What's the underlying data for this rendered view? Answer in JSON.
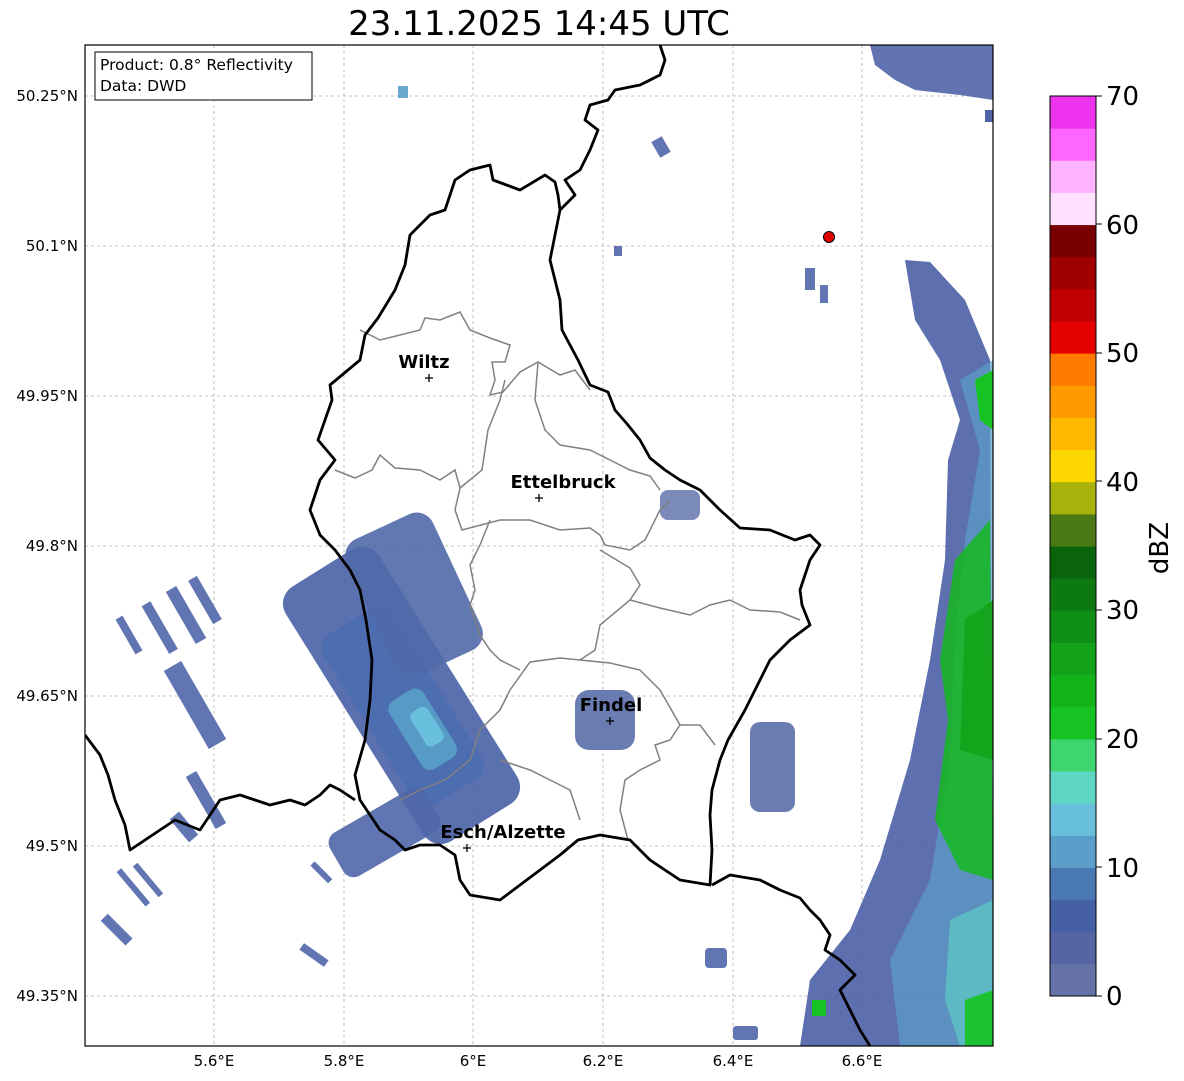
{
  "title": "23.11.2025 14:45 UTC",
  "info_box": {
    "line1": "Product: 0.8° Reflectivity",
    "line2": "Data: DWD"
  },
  "axes": {
    "lon_ticks": [
      "5.6°E",
      "5.8°E",
      "6°E",
      "6.2°E",
      "6.4°E",
      "6.6°E"
    ],
    "lat_ticks": [
      "50.25°N",
      "50.1°N",
      "49.95°N",
      "49.8°N",
      "49.65°N",
      "49.5°N",
      "49.35°N"
    ]
  },
  "cities": [
    {
      "name": "Wiltz"
    },
    {
      "name": "Ettelbruck"
    },
    {
      "name": "Findel"
    },
    {
      "name": "Esch/Alzette"
    }
  ],
  "colorbar": {
    "label": "dBZ",
    "ticks": [
      "0",
      "10",
      "20",
      "30",
      "40",
      "50",
      "60",
      "70"
    ],
    "colors": [
      "#6673a8",
      "#5565a3",
      "#4560a5",
      "#4a78b3",
      "#5b9ec9",
      "#68c0dc",
      "#5fd6c4",
      "#3ed46e",
      "#15c322",
      "#14b31b",
      "#12a318",
      "#0f8e15",
      "#0d7a11",
      "#0a640c",
      "#4b7a14",
      "#a8b20a",
      "#ffd700",
      "#ffb800",
      "#ff9a00",
      "#ff7a00",
      "#e50000",
      "#c00000",
      "#a00000",
      "#7a0000",
      "#ffe0ff",
      "#ffb2ff",
      "#ff66ff",
      "#ee33ee"
    ]
  },
  "colors": {
    "border": "#000000",
    "canton": "#808080",
    "marker": "#e00000"
  }
}
